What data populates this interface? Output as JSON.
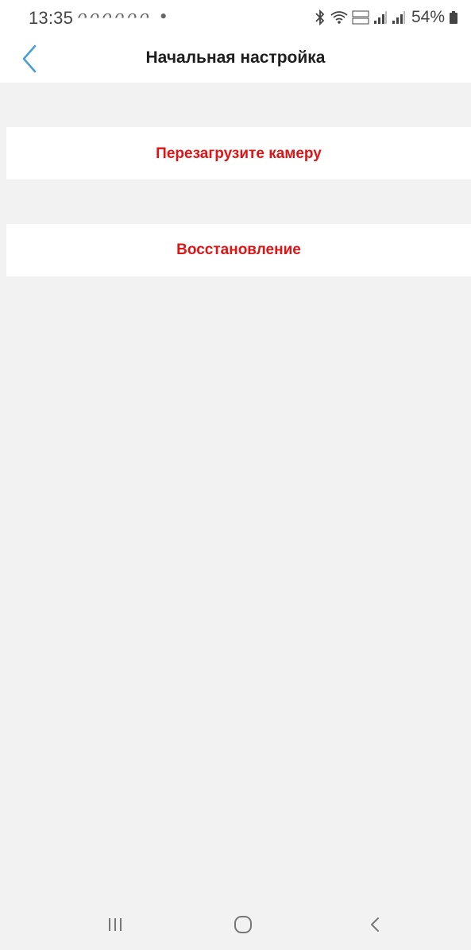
{
  "status_bar": {
    "time": "13:35",
    "notification_icons": "ᴖᴖᴖᴖᴖᴖ •",
    "battery": "54%",
    "icons": [
      "bluetooth-icon",
      "wifi-icon",
      "volte-icon",
      "signal-icon",
      "signal-icon",
      "battery-icon"
    ]
  },
  "header": {
    "title": "Начальная настройка",
    "back_icon": "chevron-left-icon"
  },
  "actions": {
    "restart_label": "Перезагрузите камеру",
    "restore_label": "Восстановление"
  },
  "nav_bar": {
    "icons": [
      "recents-icon",
      "home-icon",
      "back-icon"
    ]
  },
  "colors": {
    "accent_red": "#e01414",
    "back_blue": "#4a9fd8",
    "background": "#f2f2f2"
  }
}
